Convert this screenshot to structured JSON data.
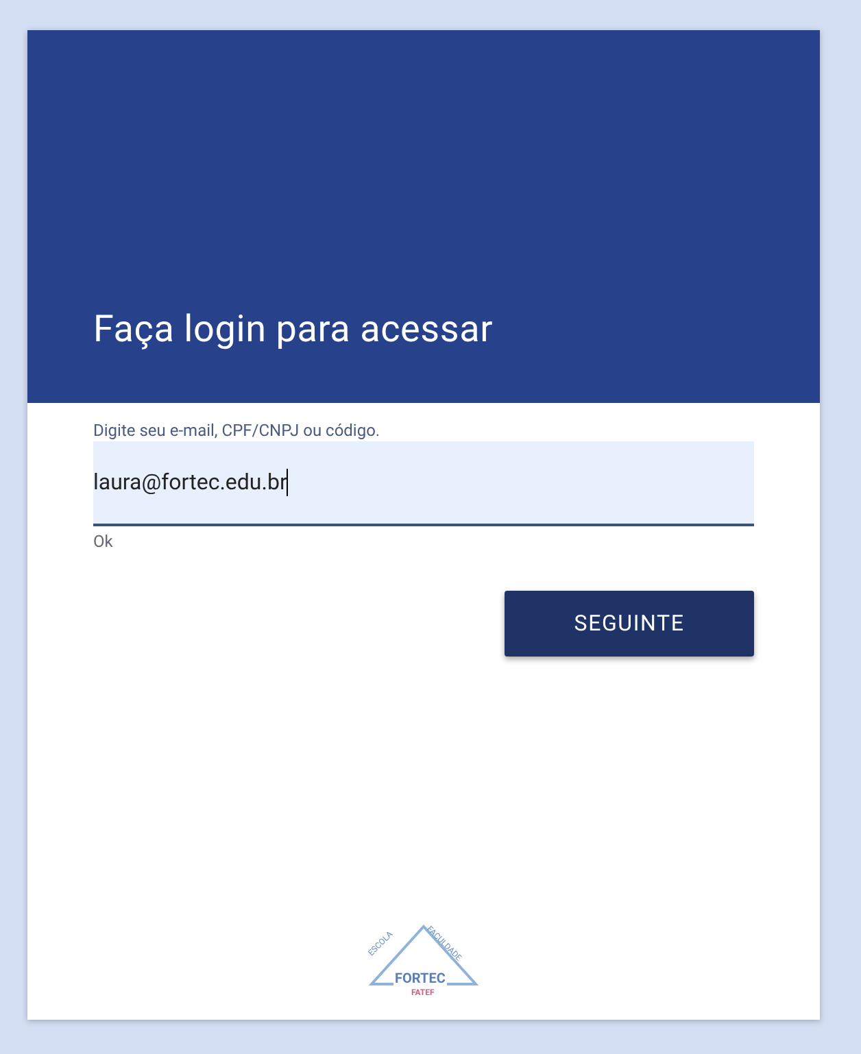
{
  "header": {
    "title": "Faça login para acessar"
  },
  "login_field": {
    "label": "Digite seu e-mail, CPF/CNPJ ou código.",
    "value": "laura@fortec.edu.br",
    "focused": true,
    "hint": "Ok"
  },
  "next_button": {
    "label": "SEGUINTE"
  },
  "logo": {
    "top_left": "ESCOLA",
    "top_right": "FACULDADE",
    "name": "FORTEC",
    "subtitle": "FATEF"
  }
}
